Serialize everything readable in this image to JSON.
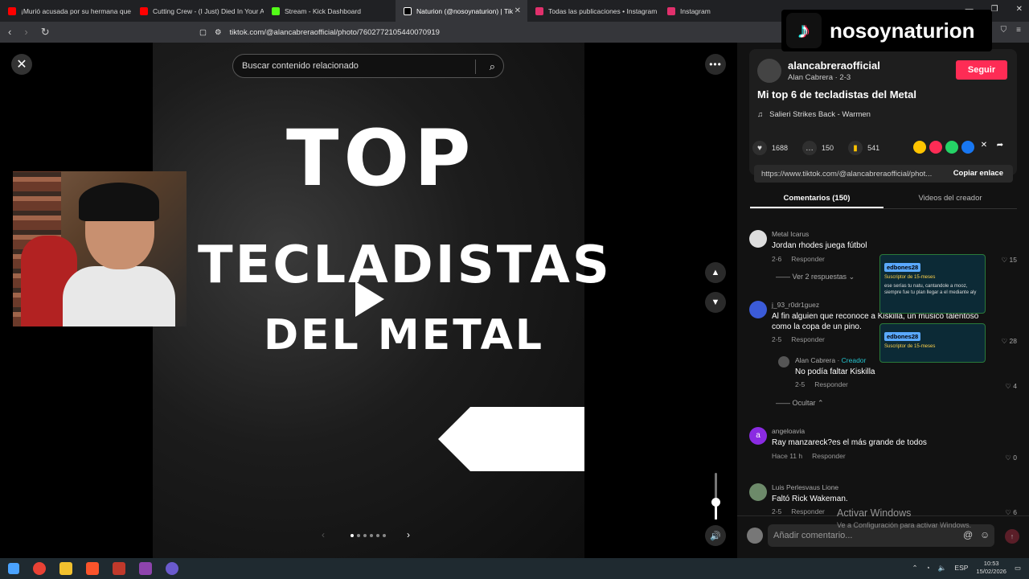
{
  "browser": {
    "tabs": [
      {
        "title": "¡Murió acusada por su hermana que",
        "color": "#ff0000",
        "active": false
      },
      {
        "title": "Cutting Crew - (I Just) Died In Your A",
        "color": "#ff0000",
        "active": false
      },
      {
        "title": "Stream - Kick Dashboard",
        "color": "#53fc18",
        "active": false
      },
      {
        "title": "Naturion (@nosoynaturion) | Tik",
        "color": "#ffffff",
        "active": true
      },
      {
        "title": "Todas las publicaciones • Instagram",
        "color": "#e1306c",
        "active": false
      },
      {
        "title": "Instagram",
        "color": "#e1306c",
        "active": false
      }
    ],
    "url": "tiktok.com/@alancabreraofficial/photo/7602772105440070919"
  },
  "brand_overlay": {
    "text": "nosoynaturion"
  },
  "viewer": {
    "search_placeholder": "Buscar contenido relacionado",
    "photo_text": {
      "line1": "TOP",
      "line2": "TECLADISTAS",
      "line3": "DEL METAL"
    },
    "dots_total": 6,
    "dots_active": 0,
    "volume_level": 0.4
  },
  "post": {
    "username": "alancabreraofficial",
    "subtitle": "Alan Cabrera · 2-3",
    "follow_label": "Seguir",
    "title": "Mi top 6 de tecladistas del Metal",
    "music": "Salieri Strikes Back - Warmen",
    "likes": "1688",
    "comments": "150",
    "saves": "541",
    "link": "https://www.tiktok.com/@alancabreraofficial/phot...",
    "copy_label": "Copiar enlace",
    "tab_comments": "Comentarios (150)",
    "tab_videos": "Videos del creador",
    "accent": "#fe2c55"
  },
  "comments": [
    {
      "user": "Metal Icarus",
      "text": "Jordan rhodes juega fútbol",
      "date": "2-6",
      "reply": "Responder",
      "likes": "15",
      "replies_label": "Ver 2 respuestas"
    },
    {
      "user": "j_93_r0dr1guez",
      "text": "Al fin alguien que reconoce a Kiskilla, un músico talentoso como la copa de un pino.",
      "date": "2-5",
      "reply": "Responder",
      "likes": "28"
    },
    {
      "user": "Alan Cabrera",
      "creator_tag": "Creador",
      "text": "No podía faltar Kiskilla",
      "date": "2-5",
      "reply": "Responder",
      "likes": "4",
      "hide_label": "Ocultar"
    },
    {
      "user": "angeloavia",
      "avatar_letter": "a",
      "text": "Ray manzareck?es el más grande de todos",
      "date": "Hace 11 h",
      "reply": "Responder",
      "likes": "0"
    },
    {
      "user": "Luis Perlesvaus Lione",
      "text": "Faltó Rick Wakeman.",
      "date": "2-5",
      "reply": "Responder",
      "likes": "6"
    }
  ],
  "sub_cards": [
    {
      "name": "edbones28",
      "tier": "Suscriptor de 15-meses",
      "message": "ese serías tu natu, cantandole a mooz, siempre fue tu plan llegar a el mediante aly"
    },
    {
      "name": "edbones28",
      "tier": "Suscriptor de 15-meses",
      "message": ""
    }
  ],
  "compose": {
    "placeholder": "Añadir comentario..."
  },
  "watermark": {
    "line1": "Activar Windows",
    "line2": "Ve a Configuración para activar Windows."
  },
  "taskbar": {
    "lang": "ESP",
    "time": "10:53",
    "date": "15/02/2026"
  }
}
